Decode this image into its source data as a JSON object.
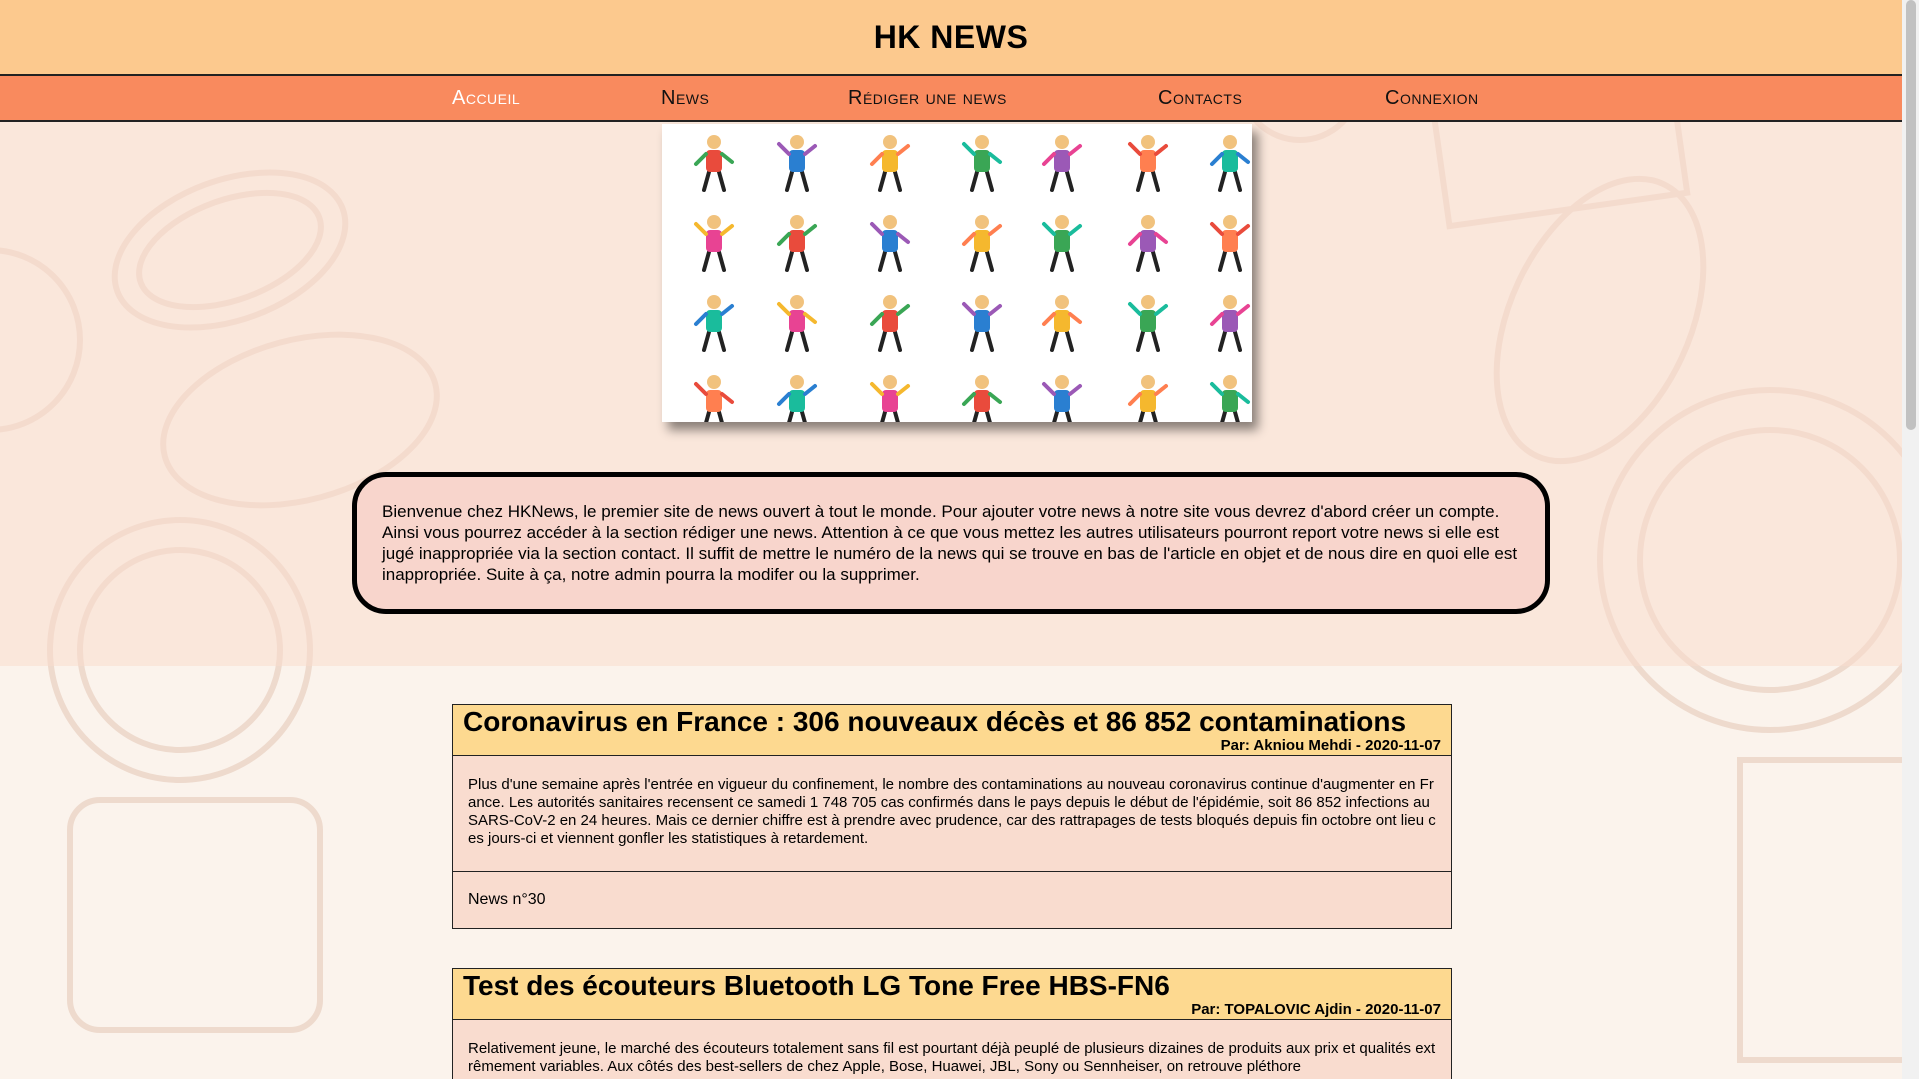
{
  "site": {
    "title": "HK NEWS"
  },
  "nav": {
    "items": [
      "Accueil",
      "News",
      "Rédiger une news",
      "Contacts",
      "Connexion"
    ]
  },
  "welcome": {
    "text": "Bienvenue chez HKNews, le premier site de news ouvert à tout le monde. Pour ajouter votre news à notre site vous devrez d'abord créer un compte. Ainsi vous pourrez accéder à la section rédiger une news. Attention à ce que vous mettez les autres utilisateurs pourront report votre news si elle est jugé inappropriée via la section contact. Il suffit de mettre le numéro de la news qui se trouve en bas de l'article en objet et de nous dire en quoi elle est inappropriée. Suite à ça, notre admin pourra la modifer ou la supprimer."
  },
  "articles": [
    {
      "title": "Coronavirus en France : 306 nouveaux décès et 86 852 contaminations",
      "byline": "Par: Akniou Mehdi - 2020-11-07",
      "body": "Plus d'une semaine après l'entrée en vigueur du confinement, le nombre des contaminations au nouveau coronavirus continue d'augmenter en France. Les autorités sanitaires recensent ce samedi 1 748 705 cas confirmés dans le pays depuis le début de l'épidémie, soit 86 852 infections au SARS-CoV-2 en 24 heures. Mais ce dernier chiffre est à prendre avec prudence, car des rattrapages de tests bloqués depuis fin octobre ont lieu ces jours-ci et viennent gonfler les statistiques à retardement.",
      "footer": "News n°30"
    },
    {
      "title": "Test des écouteurs Bluetooth LG Tone Free HBS-FN6",
      "byline": "Par: TOPALOVIC Ajdin - 2020-11-07",
      "body": "Relativement jeune, le marché des écouteurs totalement sans fil est pourtant déjà peuplé de plusieurs dizaines de produits aux prix et qualités extrêmement variables. Aux côtés des best-sellers de chez Apple, Bose, Huawei, JBL, Sony ou Sennheiser, on retrouve pléthore"
    }
  ]
}
